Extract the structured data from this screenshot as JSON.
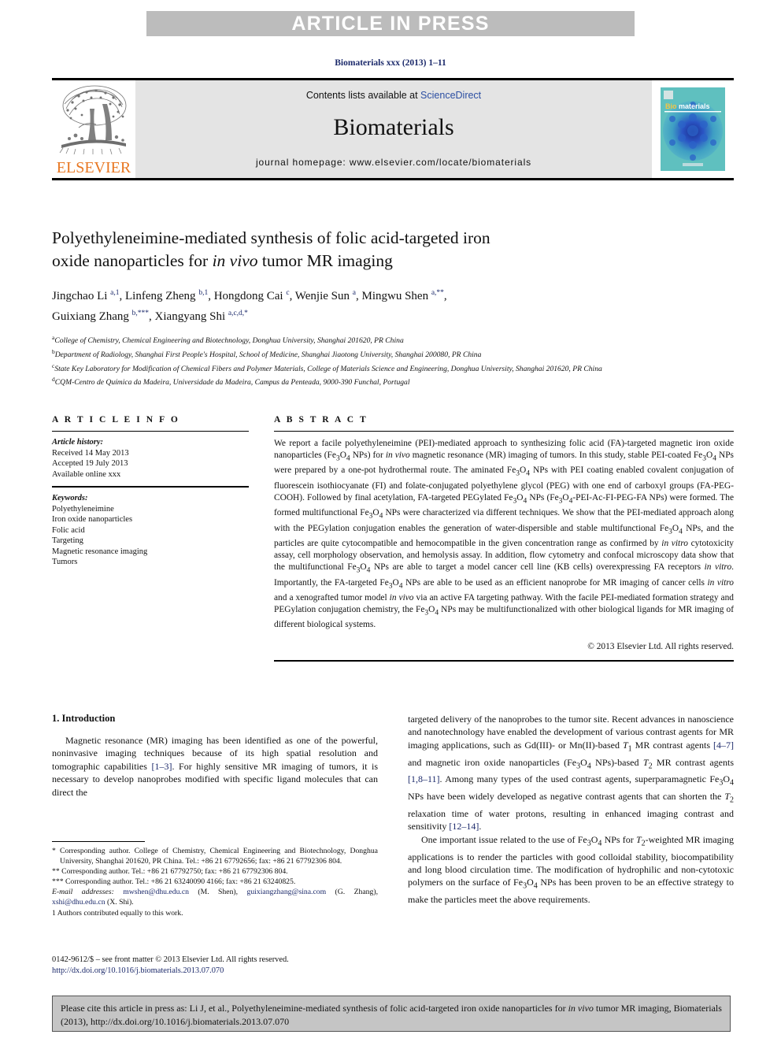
{
  "banner": {
    "label": "ARTICLE IN PRESS"
  },
  "journal_ref": "Biomaterials xxx (2013) 1–11",
  "header": {
    "contents_prefix": "Contents lists available at ",
    "sciencedirect": "ScienceDirect",
    "journal_name": "Biomaterials",
    "homepage": "journal homepage: www.elsevier.com/locate/biomaterials",
    "publisher_logo_text": "ELSEVIER",
    "cover_title": "Biomaterials",
    "accent_orange": "#e87722",
    "link_blue": "#2b4ea2",
    "banner_gray": "#bcbcbc",
    "header_gray": "#e4e4e4"
  },
  "title": {
    "line1": "Polyethyleneimine-mediated synthesis of folic acid-targeted iron",
    "line2_pre": "oxide nanoparticles for ",
    "line2_italic": "in vivo",
    "line2_post": " tumor MR imaging"
  },
  "authors": {
    "list": "Jingchao Li a,1, Linfeng Zheng b,1, Hongdong Cai c, Wenjie Sun a, Mingwu Shen a,**, Guixiang Zhang b,***, Xiangyang Shi a,c,d,*"
  },
  "affiliations": [
    {
      "mark": "a",
      "text": "College of Chemistry, Chemical Engineering and Biotechnology, Donghua University, Shanghai 201620, PR China"
    },
    {
      "mark": "b",
      "text": "Department of Radiology, Shanghai First People's Hospital, School of Medicine, Shanghai Jiaotong University, Shanghai 200080, PR China"
    },
    {
      "mark": "c",
      "text": "State Key Laboratory for Modification of Chemical Fibers and Polymer Materials, College of Materials Science and Engineering, Donghua University, Shanghai 201620, PR China"
    },
    {
      "mark": "d",
      "text": "CQM-Centro de Química da Madeira, Universidade da Madeira, Campus da Penteada, 9000-390 Funchal, Portugal"
    }
  ],
  "article_info": {
    "heading": "A R T I C L E   I N F O",
    "history_label": "Article history:",
    "history": [
      "Received 14 May 2013",
      "Accepted 19 July 2013",
      "Available online xxx"
    ],
    "keywords_label": "Keywords:",
    "keywords": [
      "Polyethyleneimine",
      "Iron oxide nanoparticles",
      "Folic acid",
      "Targeting",
      "Magnetic resonance imaging",
      "Tumors"
    ]
  },
  "abstract": {
    "heading": "A B S T R A C T",
    "paragraph": "We report a facile polyethyleneimine (PEI)-mediated approach to synthesizing folic acid (FA)-targeted magnetic iron oxide nanoparticles (Fe3O4 NPs) for in vivo magnetic resonance (MR) imaging of tumors. In this study, stable PEI-coated Fe3O4 NPs were prepared by a one-pot hydrothermal route. The aminated Fe3O4 NPs with PEI coating enabled covalent conjugation of fluorescein isothiocyanate (FI) and folate-conjugated polyethylene glycol (PEG) with one end of carboxyl groups (FA-PEG-COOH). Followed by final acetylation, FA-targeted PEGylated Fe3O4 NPs (Fe3O4-PEI-Ac-FI-PEG-FA NPs) were formed. The formed multifunctional Fe3O4 NPs were characterized via different techniques. We show that the PEI-mediated approach along with the PEGylation conjugation enables the generation of water-dispersible and stable multifunctional Fe3O4 NPs, and the particles are quite cytocompatible and hemocompatible in the given concentration range as confirmed by in vitro cytotoxicity assay, cell morphology observation, and hemolysis assay. In addition, flow cytometry and confocal microscopy data show that the multifunctional Fe3O4 NPs are able to target a model cancer cell line (KB cells) overexpressing FA receptors in vitro. Importantly, the FA-targeted Fe3O4 NPs are able to be used as an efficient nanoprobe for MR imaging of cancer cells in vitro and a xenografted tumor model in vivo via an active FA targeting pathway. With the facile PEI-mediated formation strategy and PEGylation conjugation chemistry, the Fe3O4 NPs may be multifunctionalized with other biological ligands for MR imaging of different biological systems.",
    "copyright": "© 2013 Elsevier Ltd. All rights reserved."
  },
  "introduction": {
    "heading": "1. Introduction",
    "left_paragraph": "Magnetic resonance (MR) imaging has been identified as one of the powerful, noninvasive imaging techniques because of its high spatial resolution and tomographic capabilities [1–3]. For highly sensitive MR imaging of tumors, it is necessary to develop nanoprobes modified with specific ligand molecules that can direct the",
    "right_paragraph_1": "targeted delivery of the nanoprobes to the tumor site. Recent advances in nanoscience and nanotechnology have enabled the development of various contrast agents for MR imaging applications, such as Gd(III)- or Mn(II)-based T1 MR contrast agents [4–7] and magnetic iron oxide nanoparticles (Fe3O4 NPs)-based T2 MR contrast agents [1,8–11]. Among many types of the used contrast agents, superparamagnetic Fe3O4 NPs have been widely developed as negative contrast agents that can shorten the T2 relaxation time of water protons, resulting in enhanced imaging contrast and sensitivity [12–14].",
    "right_paragraph_2": "One important issue related to the use of Fe3O4 NPs for T2-weighted MR imaging applications is to render the particles with good colloidal stability, biocompatibility and long blood circulation time. The modification of hydrophilic and non-cytotoxic polymers on the surface of Fe3O4 NPs has been proven to be an effective strategy to make the particles meet the above requirements."
  },
  "footnotes": {
    "star": "* Corresponding author. College of Chemistry, Chemical Engineering and Biotechnology, Donghua University, Shanghai 201620, PR China. Tel.: +86 21 67792656; fax: +86 21 67792306 804.",
    "star2": "** Corresponding author. Tel.: +86 21 67792750; fax: +86 21 67792306 804.",
    "star3": "*** Corresponding author. Tel.: +86 21 63240090 4166; fax: +86 21 63240825.",
    "email_label": "E-mail addresses:",
    "email1": "mwshen@dhu.edu.cn",
    "email1_owner": " (M. Shen), ",
    "email2": "guixiangzhang@sina.com",
    "email2_owner": " (G. Zhang), ",
    "email3": "xshi@dhu.edu.cn",
    "email3_owner": " (X. Shi).",
    "equal": "1  Authors contributed equally to this work."
  },
  "issn_block": {
    "line1": "0142-9612/$ – see front matter © 2013 Elsevier Ltd. All rights reserved.",
    "doi": "http://dx.doi.org/10.1016/j.biomaterials.2013.07.070"
  },
  "cite_box": {
    "pre": "Please cite this article in press as: Li J, et al., Polyethyleneimine-mediated synthesis of folic acid-targeted iron oxide nanoparticles for ",
    "italic": "in vivo",
    "post": " tumor MR imaging, Biomaterials (2013), http://dx.doi.org/10.1016/j.biomaterials.2013.07.070"
  }
}
